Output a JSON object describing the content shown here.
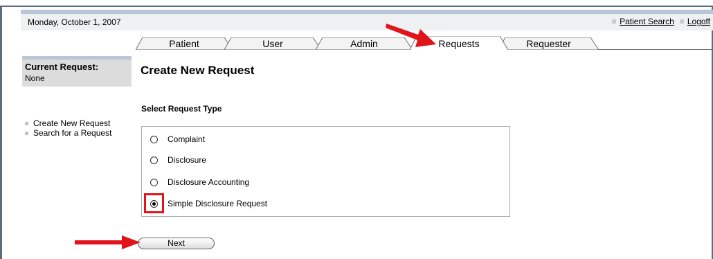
{
  "header": {
    "date": "Monday, October 1, 2007",
    "links": [
      "Patient Search",
      "Logoff"
    ]
  },
  "tabs": [
    {
      "label": "Patient",
      "active": false
    },
    {
      "label": "User",
      "active": false
    },
    {
      "label": "Admin",
      "active": false
    },
    {
      "label": "Requests",
      "active": true
    },
    {
      "label": "Requester",
      "active": false
    }
  ],
  "sidebar": {
    "current_label": "Current Request:",
    "current_value": "None",
    "links": [
      "Create New Request",
      "Search for a Request"
    ]
  },
  "main": {
    "title": "Create New Request",
    "section": "Select Request Type",
    "options": [
      {
        "label": "Complaint",
        "checked": false
      },
      {
        "label": "Disclosure",
        "checked": false
      },
      {
        "label": "Disclosure Accounting",
        "checked": false
      },
      {
        "label": "Simple Disclosure Request",
        "checked": true
      }
    ],
    "next_label": "Next"
  },
  "colors": {
    "annotation_red": "#e1141b",
    "header_accent": "#b8c7d7"
  }
}
